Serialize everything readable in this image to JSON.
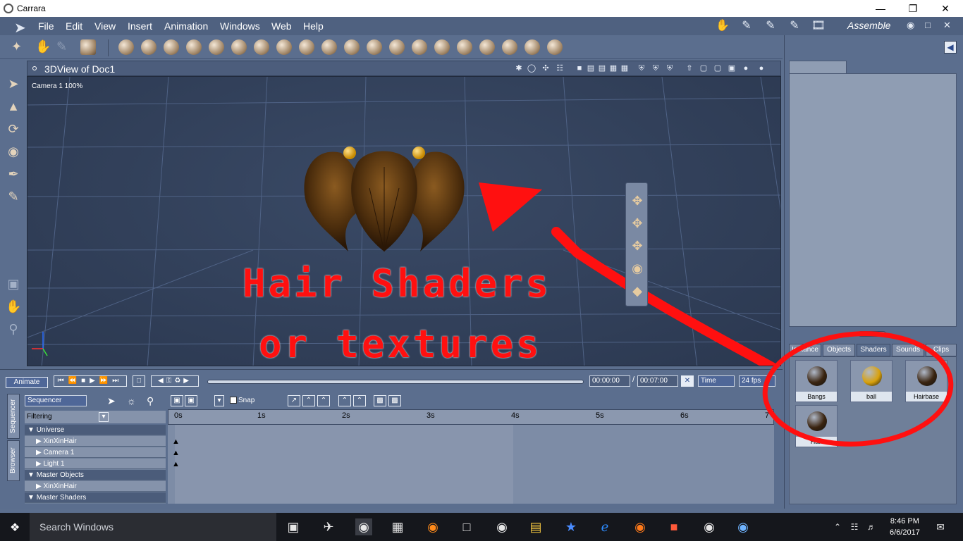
{
  "window": {
    "title": "Carrara"
  },
  "menu": {
    "items": [
      "File",
      "Edit",
      "View",
      "Insert",
      "Animation",
      "Windows",
      "Web",
      "Help"
    ],
    "room": "Assemble"
  },
  "viewport": {
    "title": "3DView of Doc1",
    "camera_label": "Camera 1 100%"
  },
  "annotation": {
    "line1": "Hair Shaders",
    "line2": "or textures",
    "color": "#ff1010"
  },
  "timeline": {
    "animate_label": "Animate",
    "current_time": "00:00:00",
    "separator": "/",
    "end_time": "00:07:00",
    "time_mode": "Time",
    "fps": "24 fps",
    "mode_select": "Sequencer",
    "snap_label": "Snap",
    "filtering_label": "Filtering",
    "side_tabs": [
      "Sequencer",
      "Browser"
    ],
    "ruler_ticks": [
      "0s",
      "1s",
      "2s",
      "3s",
      "4s",
      "5s",
      "6s",
      "7"
    ],
    "tree": [
      {
        "label": "Universe",
        "type": "group"
      },
      {
        "label": "XinXinHair",
        "type": "item"
      },
      {
        "label": "Camera 1",
        "type": "item"
      },
      {
        "label": "Light 1",
        "type": "item"
      },
      {
        "label": "Master Objects",
        "type": "group"
      },
      {
        "label": "XinXinHair",
        "type": "item"
      },
      {
        "label": "Master Shaders",
        "type": "group"
      }
    ]
  },
  "browser": {
    "tabs": [
      "Instance",
      "Objects",
      "Shaders",
      "Sounds",
      "Clips"
    ],
    "selected_tab": "Shaders",
    "shaders": [
      {
        "name": "Bangs",
        "color": "#3a2410"
      },
      {
        "name": "ball",
        "color": "#d9a10c"
      },
      {
        "name": "Hairbase",
        "color": "#3a2410"
      },
      {
        "name": "Hair",
        "color": "#3a2410"
      }
    ]
  },
  "taskbar": {
    "search_placeholder": "Search Windows",
    "time": "8:46 PM",
    "date": "6/6/2017"
  }
}
